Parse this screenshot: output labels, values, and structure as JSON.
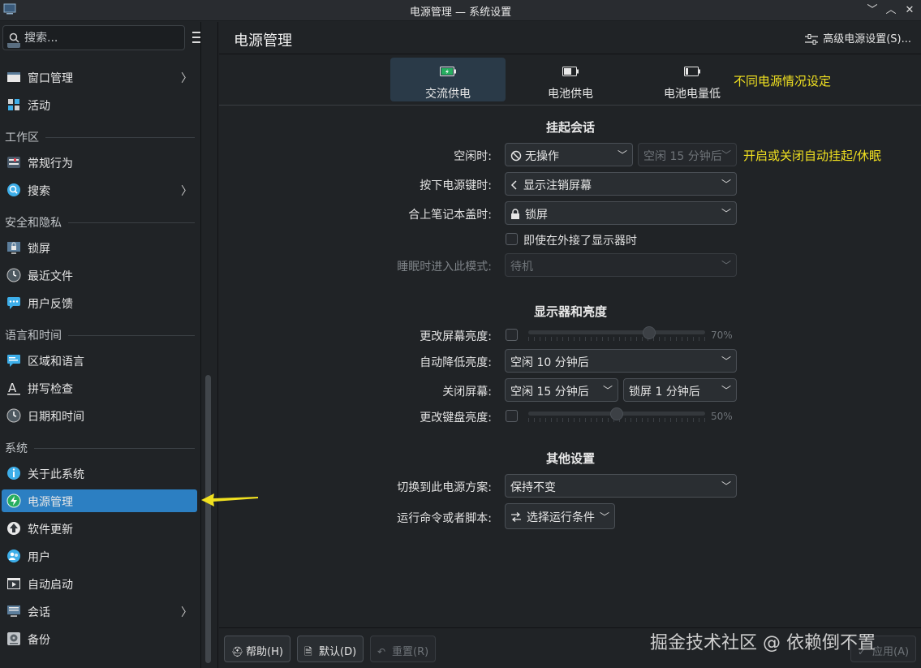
{
  "window": {
    "title": "电源管理 — 系统设置",
    "minimize_glyph": "﹀",
    "maximize_glyph": "︿",
    "close_glyph": "✕"
  },
  "sidebar": {
    "search_placeholder": "搜索...",
    "items": [
      {
        "label": "窗口管理",
        "icon": "window-icon",
        "has_chevron": true
      },
      {
        "label": "活动",
        "icon": "activities-icon",
        "has_chevron": false
      },
      {
        "label": "常规行为",
        "icon": "general-behavior-icon",
        "has_chevron": false
      },
      {
        "label": "搜索",
        "icon": "search-icon",
        "has_chevron": true
      },
      {
        "label": "锁屏",
        "icon": "lock-screen-icon",
        "has_chevron": false
      },
      {
        "label": "最近文件",
        "icon": "clock-icon",
        "has_chevron": false
      },
      {
        "label": "用户反馈",
        "icon": "feedback-icon",
        "has_chevron": false
      },
      {
        "label": "区域和语言",
        "icon": "region-icon",
        "has_chevron": false
      },
      {
        "label": "拼写检查",
        "icon": "spell-icon",
        "has_chevron": false
      },
      {
        "label": "日期和时间",
        "icon": "clock-icon",
        "has_chevron": false
      },
      {
        "label": "关于此系统",
        "icon": "info-icon",
        "has_chevron": false
      },
      {
        "label": "电源管理",
        "icon": "power-icon",
        "has_chevron": false,
        "active": true
      },
      {
        "label": "软件更新",
        "icon": "update-icon",
        "has_chevron": false
      },
      {
        "label": "用户",
        "icon": "users-icon",
        "has_chevron": false
      },
      {
        "label": "自动启动",
        "icon": "autostart-icon",
        "has_chevron": false
      },
      {
        "label": "会话",
        "icon": "session-icon",
        "has_chevron": true
      },
      {
        "label": "备份",
        "icon": "backup-icon",
        "has_chevron": false
      }
    ],
    "sections": {
      "workspace": "工作区",
      "security": "安全和隐私",
      "language": "语言和时间",
      "system": "系统"
    },
    "chevron_glyph": "〉"
  },
  "header": {
    "title": "电源管理",
    "advanced_button": "高级电源设置(S)..."
  },
  "tabs": [
    {
      "label": "交流供电",
      "active": true
    },
    {
      "label": "电池供电",
      "active": false
    },
    {
      "label": "电池电量低",
      "active": false
    }
  ],
  "annotations": {
    "tabs_note": "不同电源情况设定",
    "suspend_note": "开启或关闭自动挂起/休眠"
  },
  "suspend": {
    "section_title": "挂起会话",
    "idle_label": "空闲时:",
    "idle_value": "无操作",
    "idle_delay": "空闲 15 分钟后",
    "power_button_label": "按下电源键时:",
    "power_button_value": "显示注销屏幕",
    "lid_label": "合上笔记本盖时:",
    "lid_value": "锁屏",
    "external_display_checkbox": "即使在外接了显示器时",
    "sleep_mode_label": "睡眠时进入此模式:",
    "sleep_mode_value": "待机"
  },
  "display": {
    "section_title": "显示器和亮度",
    "screen_brightness_label": "更改屏幕亮度:",
    "screen_brightness_pct": "70%",
    "screen_brightness_value": 0.7,
    "dim_label": "自动降低亮度:",
    "dim_value": "空闲 10 分钟后",
    "turn_off_label": "关闭屏幕:",
    "turn_off_value": "空闲 15 分钟后",
    "turn_off_locked_value": "锁屏 1 分钟后",
    "keyboard_brightness_label": "更改键盘亮度:",
    "keyboard_brightness_pct": "50%",
    "keyboard_brightness_value": 0.5
  },
  "other": {
    "section_title": "其他设置",
    "profile_label": "切换到此电源方案:",
    "profile_value": "保持不变",
    "script_label": "运行命令或者脚本:",
    "script_value": "选择运行条件"
  },
  "footer": {
    "help": "帮助(H)",
    "defaults": "默认(D)",
    "reset": "重置(R)",
    "apply": "应用(A)"
  },
  "watermark": "掘金技术社区 @ 依赖倒不置",
  "dropdown_arrow": "﹀",
  "colors": {
    "accent": "#2c7fc2",
    "annotation": "#f0e020",
    "background": "#202326"
  }
}
